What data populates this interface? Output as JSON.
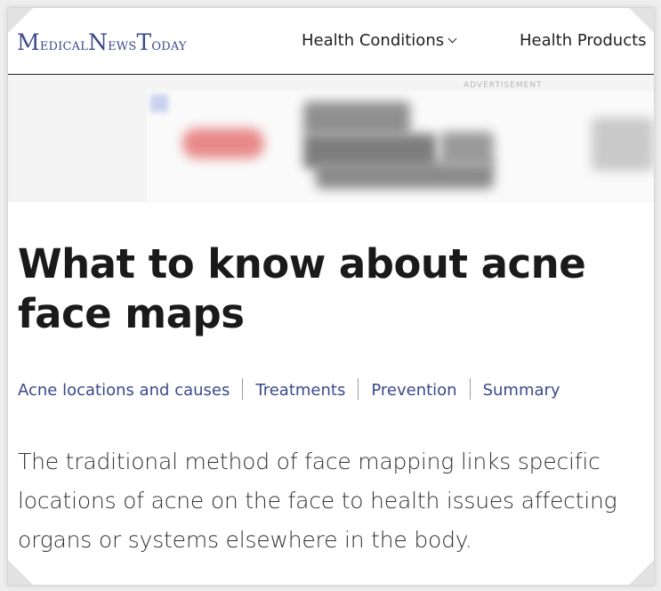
{
  "header": {
    "logo": {
      "m": "M",
      "edical": "edical",
      "n": "N",
      "ews": "ews",
      "t": "T",
      "oday": "oday"
    },
    "nav": [
      {
        "label": "Health Conditions",
        "has_dropdown": true
      },
      {
        "label": "Health Products",
        "has_dropdown": false
      }
    ]
  },
  "ad": {
    "label": "ADVERTISEMENT"
  },
  "article": {
    "title": "What to know about acne face maps",
    "toc": [
      "Acne locations and causes",
      "Treatments",
      "Prevention",
      "Summary"
    ],
    "lead": "The traditional method of face mapping links specific locations of acne on the face to health issues affecting organs or systems elsewhere in the body."
  },
  "colors": {
    "brand": "#3b4a8a",
    "headline": "#1a1a1a",
    "body_text": "#333333"
  }
}
